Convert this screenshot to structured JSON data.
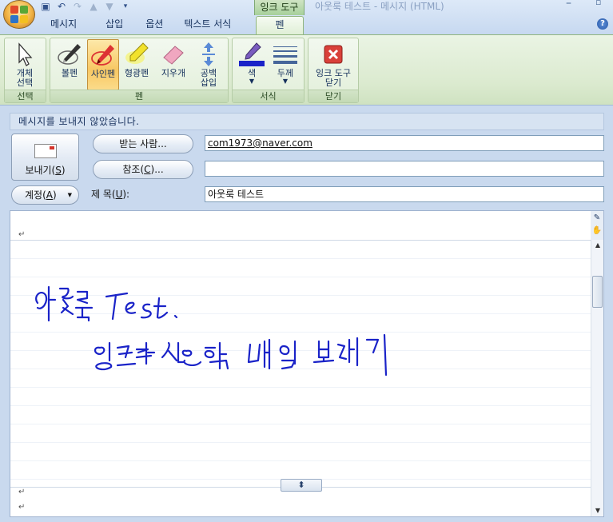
{
  "window": {
    "title": "아웃룩 테스트 - 메시지 (HTML)",
    "context_tab_title": "잉크 도구"
  },
  "tabs": [
    {
      "label": "메시지"
    },
    {
      "label": "삽입"
    },
    {
      "label": "옵션"
    },
    {
      "label": "텍스트 서식"
    },
    {
      "label": "펜"
    }
  ],
  "ribbon": {
    "groups": {
      "select": {
        "label": "선택",
        "buttons": [
          {
            "label": "개체 선택",
            "icon": "cursor-icon"
          }
        ]
      },
      "pen": {
        "label": "펜",
        "buttons": [
          {
            "label": "볼펜",
            "icon": "ballpoint-pen-icon"
          },
          {
            "label": "사인펜",
            "icon": "felt-pen-icon",
            "pressed": true
          },
          {
            "label": "형광펜",
            "icon": "highlighter-icon"
          },
          {
            "label": "지우개",
            "icon": "eraser-icon"
          },
          {
            "label": "공백 삽입",
            "icon": "insert-space-icon"
          }
        ]
      },
      "format": {
        "label": "서식",
        "buttons": [
          {
            "label": "색",
            "icon": "pen-color-icon"
          },
          {
            "label": "두께",
            "icon": "thickness-icon"
          }
        ]
      },
      "close": {
        "label": "닫기",
        "buttons": [
          {
            "label": "잉크 도구 닫기",
            "icon": "close-red-icon"
          }
        ]
      }
    }
  },
  "infobar": {
    "text": "메시지를 보내지 않았습니다."
  },
  "compose": {
    "send_label": "보내기(S)",
    "to_button": "받는 사람...",
    "cc_button": "참조(C)...",
    "account_button": "계정(A)",
    "subject_label": "제목(U):",
    "to_value": "com1973@naver.com",
    "cc_value": "",
    "subject_value": "아웃룩 테스트"
  },
  "ink": {
    "color": "#1a23c8",
    "line1": "아웃룩 Test.",
    "line2": "잉크도구 사용한 메일 보내기"
  },
  "colors": {
    "ribbon_green": "#dbeacf",
    "accent_blue": "#15305c",
    "pressed_orange": "#f8c863",
    "ink_blue": "#1a23c8"
  }
}
